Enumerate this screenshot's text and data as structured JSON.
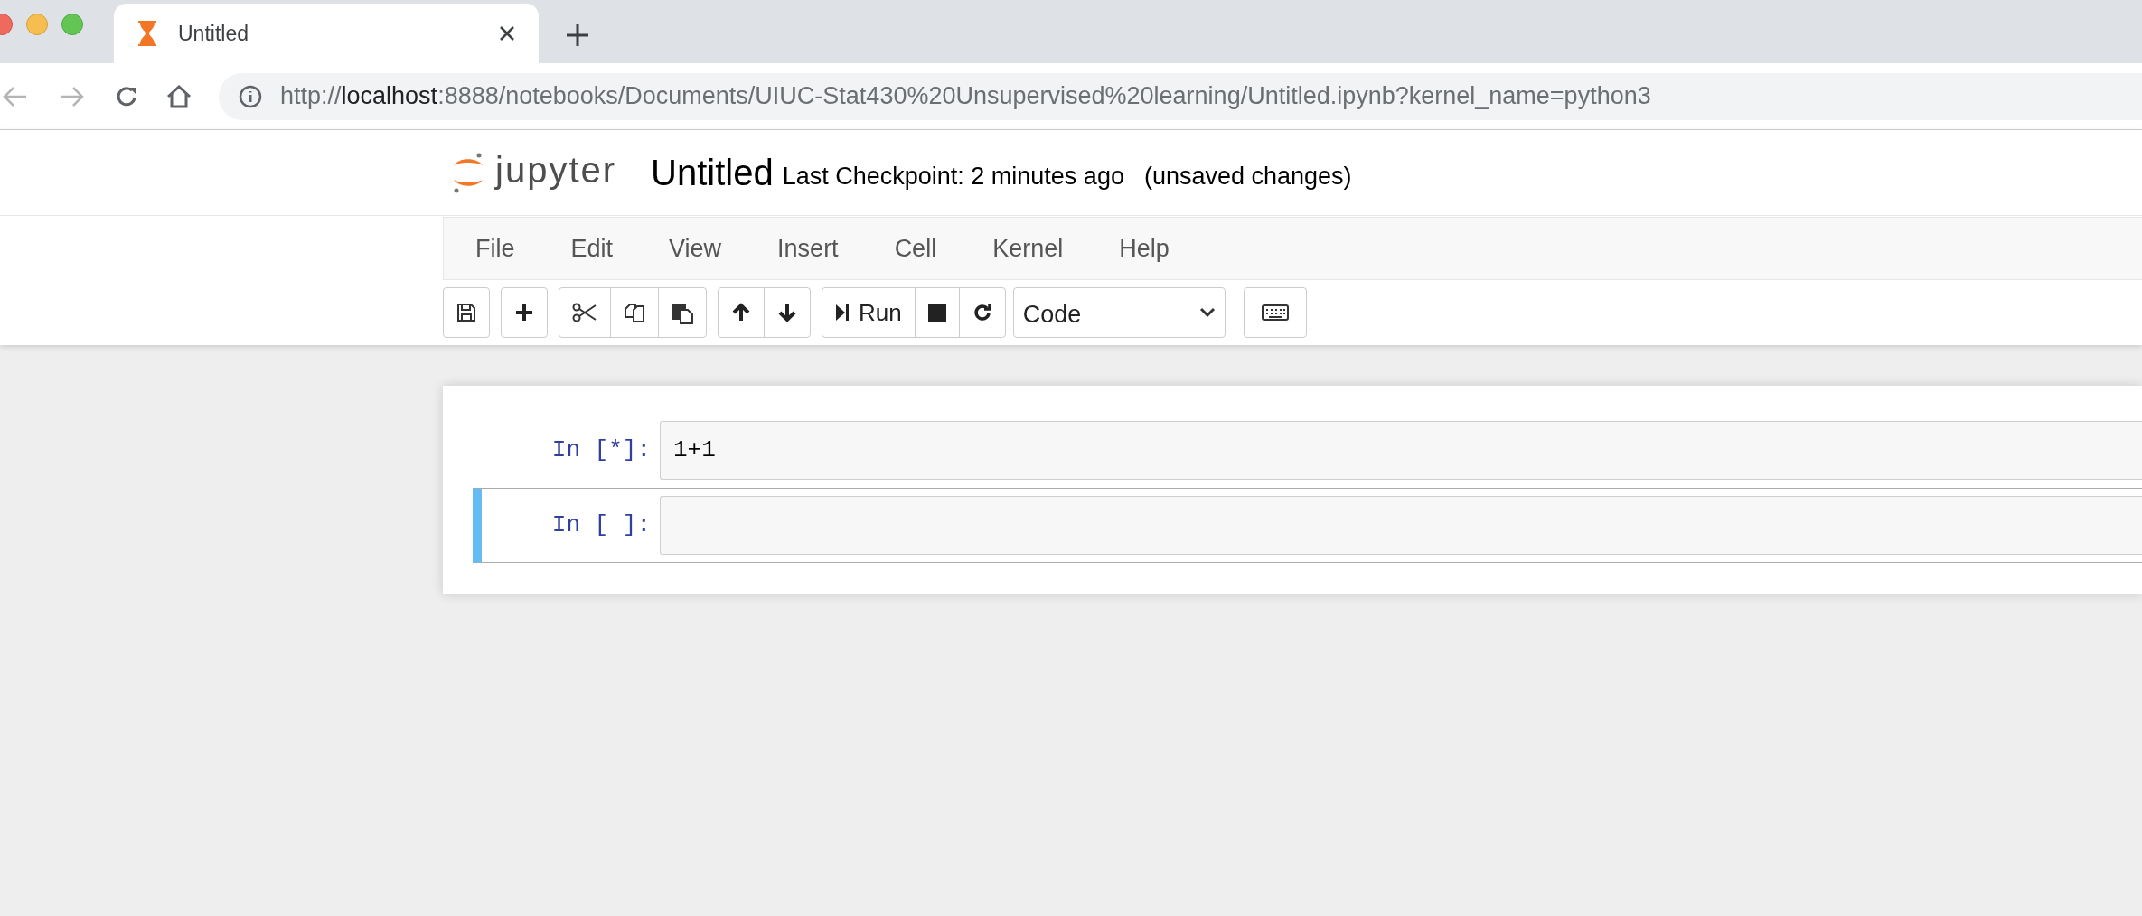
{
  "browser": {
    "tab": {
      "title": "Untitled"
    },
    "url": {
      "scheme": "http://",
      "host": "localhost",
      "rest": ":8888/notebooks/Documents/UIUC-Stat430%20Unsupervised%20learning/Untitled.ipynb?kernel_name=python3"
    }
  },
  "header": {
    "logo_text": "jupyter",
    "notebook_name": "Untitled",
    "checkpoint": "Last Checkpoint: 2 minutes ago",
    "save_status": "(unsaved changes)"
  },
  "menu": [
    "File",
    "Edit",
    "View",
    "Insert",
    "Cell",
    "Kernel",
    "Help"
  ],
  "toolbar": {
    "groups": [
      {
        "buttons": [
          {
            "kind": "save"
          }
        ]
      },
      {
        "buttons": [
          {
            "kind": "add"
          }
        ]
      },
      {
        "buttons": [
          {
            "kind": "cut"
          },
          {
            "kind": "copy"
          },
          {
            "kind": "paste"
          }
        ]
      },
      {
        "buttons": [
          {
            "kind": "up"
          },
          {
            "kind": "down"
          }
        ]
      },
      {
        "buttons": [
          {
            "kind": "run",
            "label": "Run"
          },
          {
            "kind": "stop"
          },
          {
            "kind": "restart"
          }
        ]
      }
    ],
    "cell_type": "Code",
    "after": [
      {
        "kind": "keyboard"
      }
    ]
  },
  "cells": [
    {
      "prompt": "In [*]:",
      "code": "1+1",
      "selected": false
    },
    {
      "prompt": "In [ ]:",
      "selected": true
    }
  ]
}
